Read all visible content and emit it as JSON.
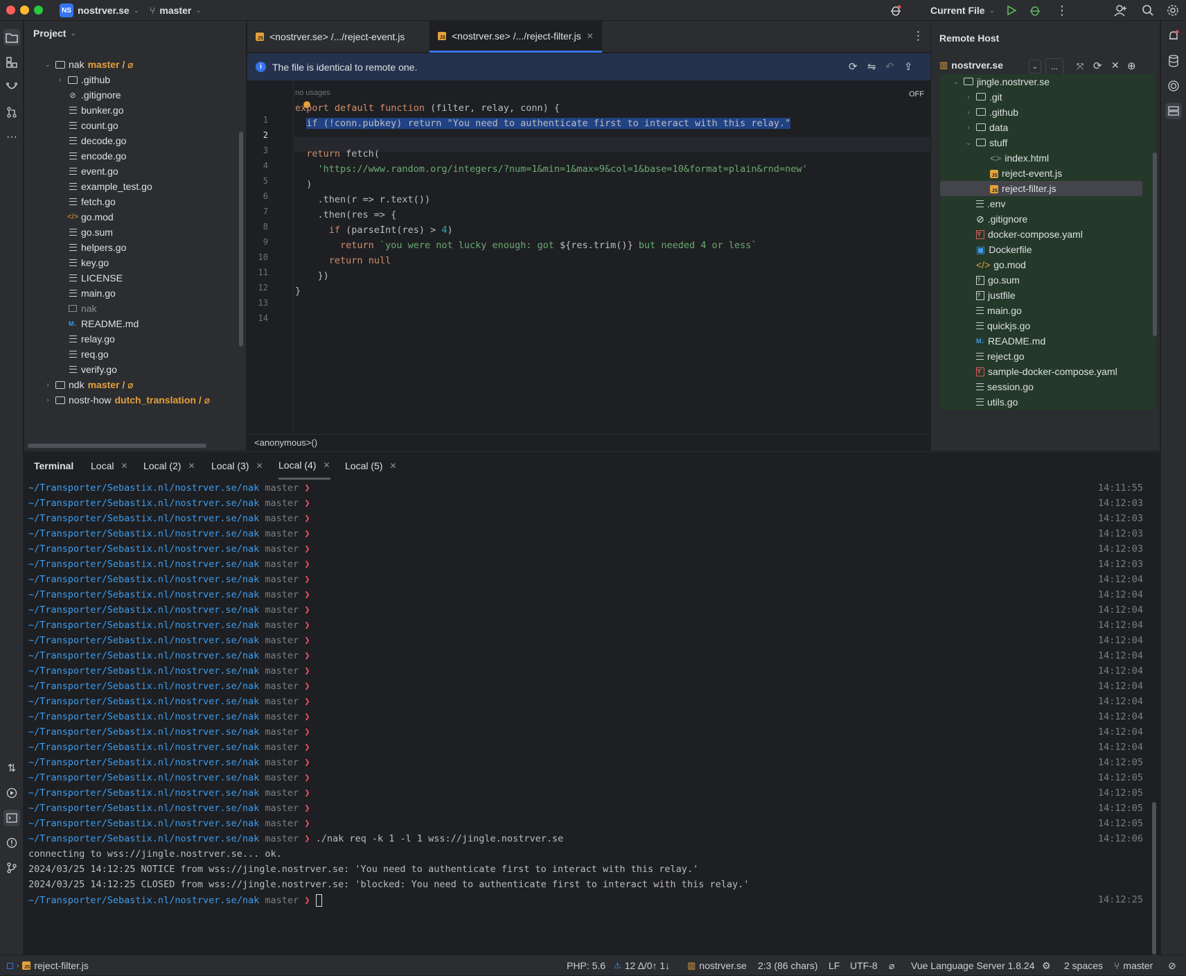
{
  "titlebar": {
    "project_badge": "NS",
    "project_name": "nostrver.se",
    "branch": "master",
    "run_config": "Current File"
  },
  "project_panel": {
    "title": "Project",
    "tree": [
      {
        "name": "nak",
        "branch": "master / ⌀",
        "type": "folder",
        "open": true,
        "depth": 1
      },
      {
        "name": ".github",
        "type": "folder",
        "open": false,
        "depth": 2
      },
      {
        "name": ".gitignore",
        "type": "ignore",
        "depth": 2
      },
      {
        "name": "bunker.go",
        "type": "file",
        "depth": 2
      },
      {
        "name": "count.go",
        "type": "file",
        "depth": 2
      },
      {
        "name": "decode.go",
        "type": "file",
        "depth": 2
      },
      {
        "name": "encode.go",
        "type": "file",
        "depth": 2
      },
      {
        "name": "event.go",
        "type": "file",
        "depth": 2
      },
      {
        "name": "example_test.go",
        "type": "file",
        "depth": 2
      },
      {
        "name": "fetch.go",
        "type": "file",
        "depth": 2
      },
      {
        "name": "go.mod",
        "type": "mod",
        "depth": 2
      },
      {
        "name": "go.sum",
        "type": "file",
        "depth": 2
      },
      {
        "name": "helpers.go",
        "type": "file",
        "depth": 2
      },
      {
        "name": "key.go",
        "type": "file",
        "depth": 2
      },
      {
        "name": "LICENSE",
        "type": "file",
        "depth": 2
      },
      {
        "name": "main.go",
        "type": "file",
        "depth": 2
      },
      {
        "name": "nak",
        "type": "binary",
        "depth": 2
      },
      {
        "name": "README.md",
        "type": "md",
        "depth": 2
      },
      {
        "name": "relay.go",
        "type": "file",
        "depth": 2
      },
      {
        "name": "req.go",
        "type": "file",
        "depth": 2
      },
      {
        "name": "verify.go",
        "type": "file",
        "depth": 2
      },
      {
        "name": "ndk",
        "branch": "master / ⌀",
        "type": "folder",
        "open": false,
        "depth": 1
      },
      {
        "name": "nostr-how",
        "branch": "dutch_translation / ⌀",
        "type": "folder",
        "open": false,
        "depth": 1
      }
    ]
  },
  "editor": {
    "tabs": [
      {
        "label": "<nostrver.se> /.../reject-event.js",
        "active": false
      },
      {
        "label": "<nostrver.se> /.../reject-filter.js",
        "active": true
      }
    ],
    "banner": "The file is identical to remote one.",
    "usages_hint": "no usages",
    "off_label": "OFF",
    "line_numbers": [
      "1",
      "2",
      "3",
      "4",
      "5",
      "6",
      "7",
      "8",
      "9",
      "10",
      "11",
      "12",
      "13",
      "14"
    ],
    "current_line": "2",
    "code": {
      "l1_kw1": "export",
      "l1_kw2": "default",
      "l1_kw3": "function",
      "l1_rest": " (filter, relay, conn) {",
      "l2_sel": "if (!conn.pubkey) return \"You need to authenticate first to interact with this relay.\"",
      "l4_kw": "return",
      "l4_fn": " fetch(",
      "l5_str": "'https://www.random.org/integers/?num=1&min=1&max=9&col=1&base=10&format=plain&rnd=new'",
      "l6": ")",
      "l7": ".then(r => r.text())",
      "l8": ".then(res => {",
      "l9_kw": "if",
      "l9_mid": " (parseInt(res) > ",
      "l9_num": "4",
      "l9_end": ")",
      "l10_kw": "return",
      "l10_a": " `you were not lucky enough: got ",
      "l10_b": "${res.trim()}",
      "l10_c": " but needed 4 or less`",
      "l11_kw": "return",
      "l11_null": " null",
      "l12": "})",
      "l13": "}"
    },
    "breadcrumb": "<anonymous>()"
  },
  "remote_host": {
    "title": "Remote Host",
    "server": "nostrver.se",
    "more_label": "...",
    "tree": [
      {
        "name": "jingle.nostrver.se",
        "type": "folder",
        "open": true,
        "depth": 1
      },
      {
        "name": ".git",
        "type": "folder",
        "open": false,
        "depth": 2
      },
      {
        "name": ".github",
        "type": "folder",
        "open": false,
        "depth": 2
      },
      {
        "name": "data",
        "type": "folder",
        "open": false,
        "depth": 2
      },
      {
        "name": "stuff",
        "type": "folder",
        "open": true,
        "depth": 2
      },
      {
        "name": "index.html",
        "type": "html",
        "depth": 3
      },
      {
        "name": "reject-event.js",
        "type": "js",
        "depth": 3
      },
      {
        "name": "reject-filter.js",
        "type": "js",
        "depth": 3,
        "selected": true
      },
      {
        "name": ".env",
        "type": "file",
        "depth": 2
      },
      {
        "name": ".gitignore",
        "type": "ignore",
        "depth": 2
      },
      {
        "name": "docker-compose.yaml",
        "type": "yaml",
        "depth": 2
      },
      {
        "name": "Dockerfile",
        "type": "docker",
        "depth": 2
      },
      {
        "name": "go.mod",
        "type": "mod",
        "depth": 2
      },
      {
        "name": "go.sum",
        "type": "unknown",
        "depth": 2
      },
      {
        "name": "justfile",
        "type": "unknown",
        "depth": 2
      },
      {
        "name": "main.go",
        "type": "file",
        "depth": 2
      },
      {
        "name": "quickjs.go",
        "type": "file",
        "depth": 2
      },
      {
        "name": "README.md",
        "type": "md",
        "depth": 2
      },
      {
        "name": "reject.go",
        "type": "file",
        "depth": 2
      },
      {
        "name": "sample-docker-compose.yaml",
        "type": "yaml",
        "depth": 2
      },
      {
        "name": "session.go",
        "type": "file",
        "depth": 2
      },
      {
        "name": "utils.go",
        "type": "file",
        "depth": 2
      }
    ]
  },
  "terminal": {
    "title": "Terminal",
    "tabs": [
      "Local",
      "Local (2)",
      "Local (3)",
      "Local (4)",
      "Local (5)"
    ],
    "active_tab": "Local (4)",
    "path": "~/Transporter/Sebastix.nl/nostrver.se/nak",
    "branch": "master",
    "prompt_symbol": "❯",
    "prompt_times": [
      "14:11:55",
      "14:12:03",
      "14:12:03",
      "14:12:03",
      "14:12:03",
      "14:12:03",
      "14:12:04",
      "14:12:04",
      "14:12:04",
      "14:12:04",
      "14:12:04",
      "14:12:04",
      "14:12:04",
      "14:12:04",
      "14:12:04",
      "14:12:04",
      "14:12:04",
      "14:12:04",
      "14:12:05",
      "14:12:05",
      "14:12:05",
      "14:12:05",
      "14:12:05"
    ],
    "command": "./nak req -k 1 -l 1 wss://jingle.nostrver.se",
    "command_time": "14:12:06",
    "output": [
      "connecting to wss://jingle.nostrver.se... ok.",
      "2024/03/25 14:12:25 NOTICE from wss://jingle.nostrver.se: 'You need to authenticate first to interact with this relay.'",
      "2024/03/25 14:12:25 CLOSED from wss://jingle.nostrver.se: 'blocked: You need to authenticate first to interact with this relay.'"
    ],
    "last_time": "14:12:25"
  },
  "statusbar": {
    "file": "reject-filter.js",
    "php": "PHP: 5.6",
    "vcs": "12 Δ/0↑ 1↓",
    "server": "nostrver.se",
    "position": "2:3 (86 chars)",
    "line_sep": "LF",
    "encoding": "UTF-8",
    "language_server": "Vue Language Server 1.8.24",
    "indent": "2 spaces",
    "branch": "master"
  },
  "colors": {
    "accent": "#3574f0",
    "branch": "#e5a13c",
    "term_path": "#3c9df0",
    "term_prompt": "#f75464"
  }
}
